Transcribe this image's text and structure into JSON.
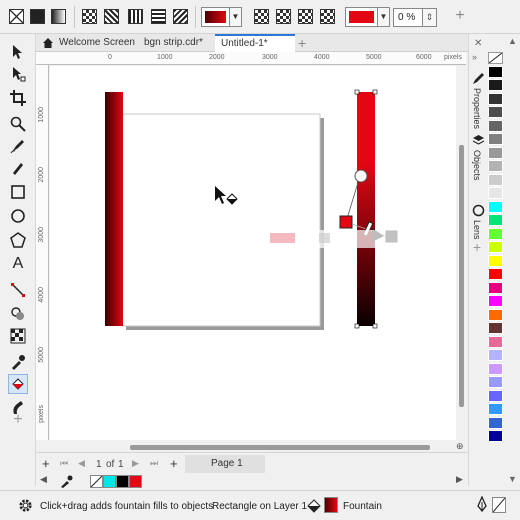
{
  "colors": {
    "accent": "#2b78d8",
    "red": "#e30613",
    "black": "#000000",
    "cyan": "#00e5e5"
  },
  "propbar": {
    "transparency_value": "0 %",
    "icons": [
      "no-fill-icon",
      "uniform-fill-icon",
      "fountain-fill-icon",
      "vector-pattern-icon",
      "bitmap-pattern-icon",
      "two-color-pattern-icon",
      "texture-fill-icon",
      "postscript-fill-icon"
    ]
  },
  "tabs": [
    {
      "label": "Welcome Screen"
    },
    {
      "label": "bgn strip.cdr*"
    },
    {
      "label": "Untitled-1*"
    }
  ],
  "ruler_top": [
    "0",
    "1000",
    "2000",
    "3000",
    "4000",
    "5000",
    "6000"
  ],
  "ruler_top_unit": "pixels",
  "ruler_left": [
    "1000",
    "2000",
    "3000",
    "4000",
    "5000"
  ],
  "ruler_left_unit": "pixels",
  "pagebar": {
    "page_of": "1",
    "of_label": "of",
    "page_total": "1",
    "page_tab": "Page 1"
  },
  "docker": {
    "properties": "Properties",
    "objects": "Objects",
    "lens": "Lens"
  },
  "palette": [
    "#ffffff",
    "#000000",
    "#1a1a1a",
    "#333333",
    "#4d4d4d",
    "#666666",
    "#808080",
    "#999999",
    "#b3b3b3",
    "#cccccc",
    "#e6e6e6",
    "#00ffff",
    "#00e676",
    "#66ff33",
    "#ccff00",
    "#ffff00",
    "#ff0000",
    "#e6007e",
    "#ff00ff",
    "#ff6a00",
    "#663333",
    "#e56a96",
    "#b3b3ff",
    "#cc99ff",
    "#9999ff",
    "#6666ff",
    "#3399ff",
    "#3366cc",
    "#000099"
  ],
  "status": {
    "hint": "Click+drag adds fountain fills to objects",
    "object": "Rectangle on Layer 1",
    "fill_type": "Fountain"
  }
}
